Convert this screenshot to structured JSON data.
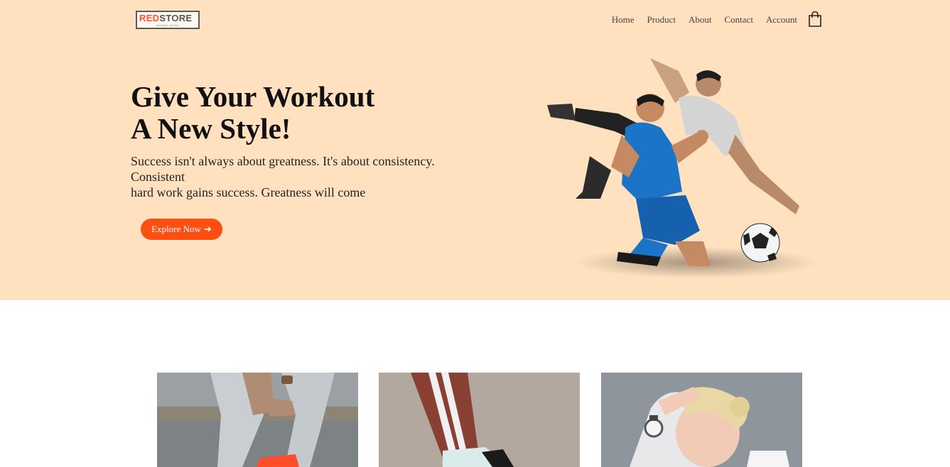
{
  "nav": {
    "logo": {
      "part1": "RED",
      "part2": "STORE",
      "tagline": "athletic choice"
    },
    "items": [
      "Home",
      "Product",
      "About",
      "Contact",
      "Account"
    ],
    "cart_icon": "shopping-bag-icon"
  },
  "hero": {
    "title_line1": "Give Your Workout",
    "title_line2": "A New Style!",
    "text_line1": "Success isn't always about greatness. It's about consistency.",
    "text_line2": "Consistent",
    "text_line3": "hard work gains success. Greatness will come",
    "button_label": "Explore Now",
    "button_icon": "➔"
  },
  "colors": {
    "header_bg": "#ffe1c0",
    "accent": "#ff4e12",
    "logo_red": "#ff523b"
  },
  "gallery": [
    {
      "name": "category-image-jeans-sneakers"
    },
    {
      "name": "category-image-track-pants-shoe"
    },
    {
      "name": "category-image-smartwatch-woman"
    }
  ]
}
